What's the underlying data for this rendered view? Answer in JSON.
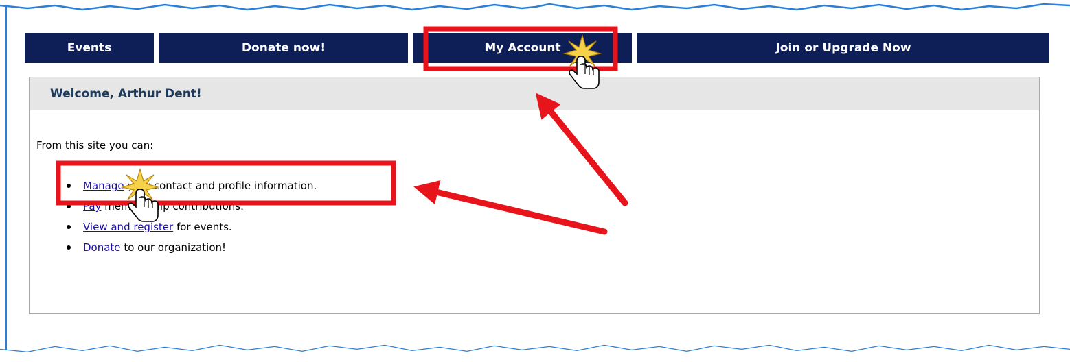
{
  "nav": {
    "tabs": [
      {
        "label": "Events"
      },
      {
        "label": "Donate now!"
      },
      {
        "label": "My Account"
      },
      {
        "label": "Join or Upgrade Now"
      }
    ]
  },
  "welcome": {
    "heading": "Welcome, Arthur Dent!",
    "intro": "From this site you can:"
  },
  "features": [
    {
      "link": "Manage",
      "text": " your contact and profile information."
    },
    {
      "link": "Pay",
      "text": " membership contributions."
    },
    {
      "link": "View and register",
      "text": " for events."
    },
    {
      "link": "Donate",
      "text": " to our organization!"
    }
  ],
  "colors": {
    "nav_background": "#0e1e57",
    "header_background": "#e6e6e6",
    "highlight": "#e8141b",
    "link": "#1a0dab"
  },
  "icons": {
    "cursor": "hand-pointer-icon",
    "click": "click-burst-icon"
  }
}
